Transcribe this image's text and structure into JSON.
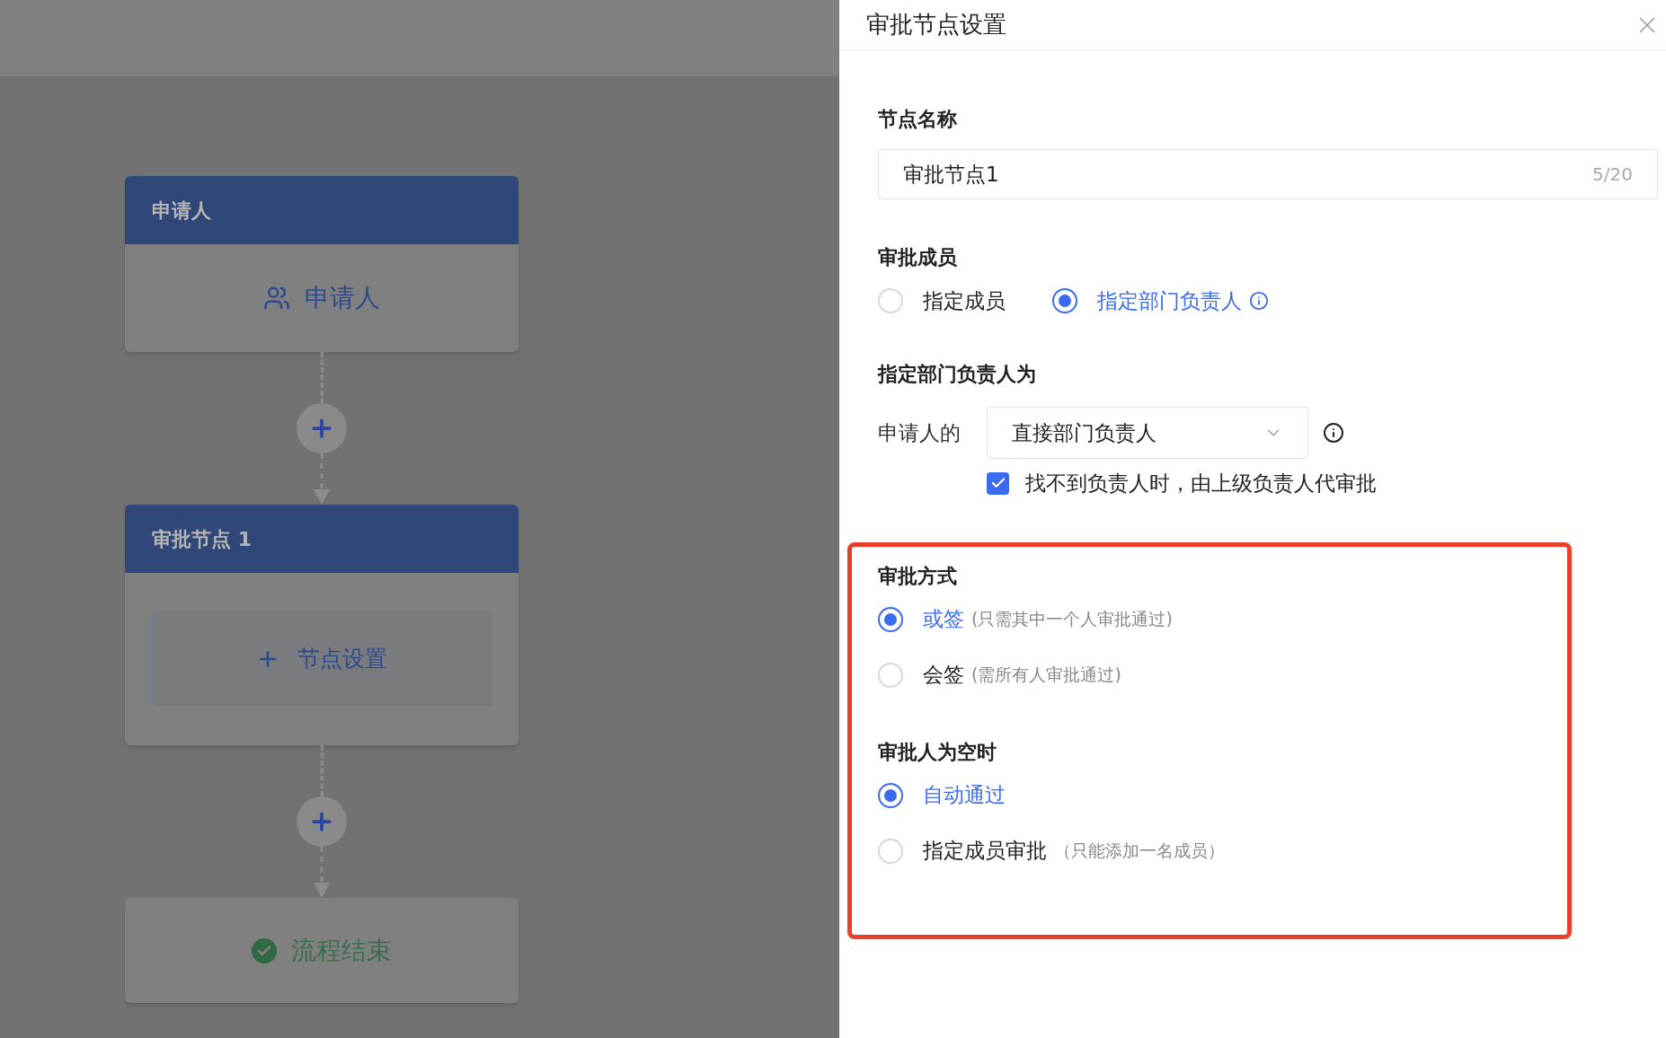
{
  "flow": {
    "nodes": [
      {
        "kind": "start",
        "header": "申请人",
        "label": "申请人"
      },
      {
        "kind": "approval",
        "header": "审批节点 1",
        "label": "节点设置"
      },
      {
        "kind": "end",
        "label": "流程结束"
      }
    ]
  },
  "panel": {
    "title": "审批节点设置",
    "sections": [
      {
        "kind": "input",
        "label": "节点名称",
        "value": "审批节点1",
        "counter": "5/20"
      },
      {
        "kind": "radio_row",
        "label": "审批成员",
        "options": [
          {
            "label": "指定成员",
            "selected": false,
            "info": false
          },
          {
            "label": "指定部门负责人",
            "selected": true,
            "info": true
          }
        ]
      },
      {
        "kind": "select",
        "label": "指定部门负责人为",
        "prefix": "申请人的",
        "value": "直接部门负责人",
        "checkbox": {
          "label": "找不到负责人时，由上级负责人代审批",
          "checked": true
        }
      }
    ],
    "highlighted_sections": [
      {
        "kind": "radio_col",
        "label": "审批方式",
        "options": [
          {
            "label": "或签",
            "hint": "(只需其中一个人审批通过)",
            "selected": true
          },
          {
            "label": "会签",
            "hint": "(需所有人审批通过)",
            "selected": false
          }
        ]
      },
      {
        "kind": "radio_col",
        "label": "审批人为空时",
        "options": [
          {
            "label": "自动通过",
            "selected": true
          },
          {
            "label": "指定成员审批",
            "hint": "（只能添加一名成员）",
            "selected": false
          }
        ]
      }
    ]
  }
}
